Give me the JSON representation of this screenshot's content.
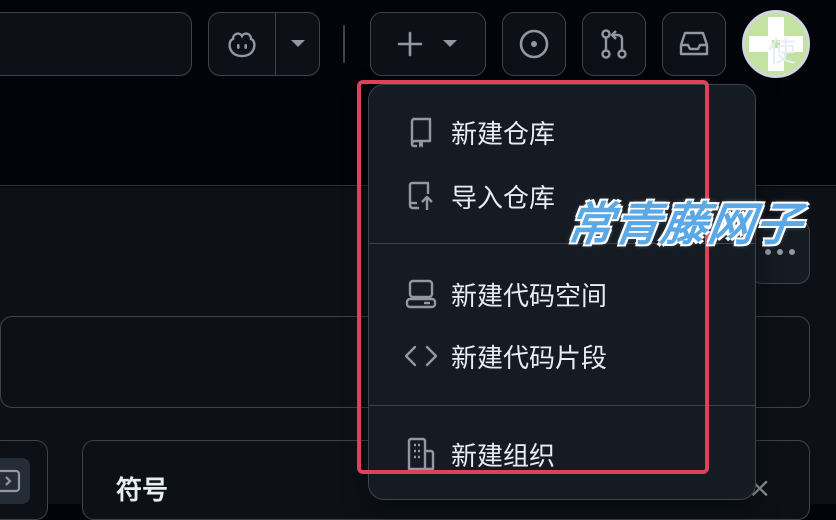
{
  "header": {
    "copilot_icon": "copilot-icon",
    "create_icon": "plus-icon",
    "issues_icon": "issue-opened-icon",
    "pulls_icon": "git-pull-request-icon",
    "inbox_icon": "inbox-icon"
  },
  "menu": {
    "items": [
      {
        "label": "新建仓库",
        "icon": "repo-icon"
      },
      {
        "label": "导入仓库",
        "icon": "repo-push-icon"
      },
      {
        "label": "新建代码空间",
        "icon": "codespaces-icon"
      },
      {
        "label": "新建代码片段",
        "icon": "code-icon"
      },
      {
        "label": "新建组织",
        "icon": "organization-icon"
      }
    ]
  },
  "page": {
    "row_text": "使",
    "panel_title": "符号",
    "panel_close": "×"
  },
  "watermark": "常青藤网子",
  "colors": {
    "background": "#010409",
    "surface": "#0d1117",
    "menu": "#151b23",
    "border": "#3d444d",
    "highlight": "#e0415a",
    "watermark": "#5aa8e6"
  }
}
